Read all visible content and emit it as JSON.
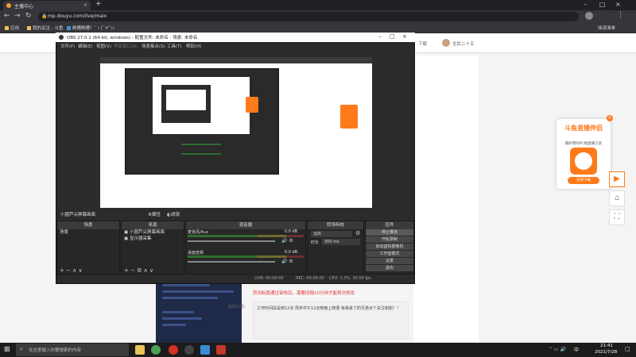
{
  "browser": {
    "tab_title": "主播中心",
    "tab_close": "×",
    "url": "mp.douyu.com/live/main",
    "bookmarks": [
      "应用",
      "我的关注 - 斗鱼",
      "刷槽刷槽！`ヽ(ﾟ∀ﾟ)ﾉ"
    ],
    "reading_list": "阅读清单",
    "download_label": "下载",
    "user_label": "全民二十五"
  },
  "obs": {
    "title": "OBS 27.0.1 (64-bit, windows) - 配置文件: 未命名 - 场景: 未命名",
    "menu": [
      "文件(F)",
      "编辑(E)",
      "视图(V)",
      "停靠窗口(D)",
      "场景集合(S)",
      "工具(T)",
      "帮助(H)"
    ],
    "source_bar_label": "小圆芦尖屏幕画面",
    "properties_label": "属性",
    "filters_label": "滤镜",
    "docks": {
      "scenes": "场景",
      "sources": "来源",
      "mixer": "混音器",
      "transitions": "转场特效",
      "controls": "控件"
    },
    "scene_items": [
      "场景"
    ],
    "source_items": [
      "小圆芦尖屏幕画面",
      "显示器采集"
    ],
    "mixer_tracks": [
      {
        "name": "麦克风/Aux",
        "db": "0.0 dB"
      },
      {
        "name": "桌面音频",
        "db": "0.0 dB"
      }
    ],
    "transition_value": "淡出",
    "duration_label": "时长",
    "duration_value": "300 ms",
    "controls": [
      "停止推流",
      "开始录制",
      "启动虚拟摄像机",
      "工作室模式",
      "设置",
      "退出"
    ],
    "status": {
      "live": "LIVE: 00:00:00",
      "rec": "REC: 00:00:00",
      "cpu": "CPU: 1.3%, 30.00 fps"
    }
  },
  "webpage": {
    "notice": "房间标题通过审核后，需要间隔10分钟才能再次修改",
    "announcement_label": "房间公告:",
    "announcement_text": "工作时间段是到12点 周末中午12点到晚上随便 有缘来了的兄弟点个关注谢谢！！",
    "promo_title": "斗鱼直播伴侣",
    "promo_subtitle": "最好用的PC端直播工具",
    "promo_button": "立即下载",
    "promo_close": "×"
  },
  "taskbar": {
    "search_placeholder": "在这里输入你要搜索的内容",
    "time": "21:41",
    "date": "2021/7/28",
    "lang": "中"
  }
}
